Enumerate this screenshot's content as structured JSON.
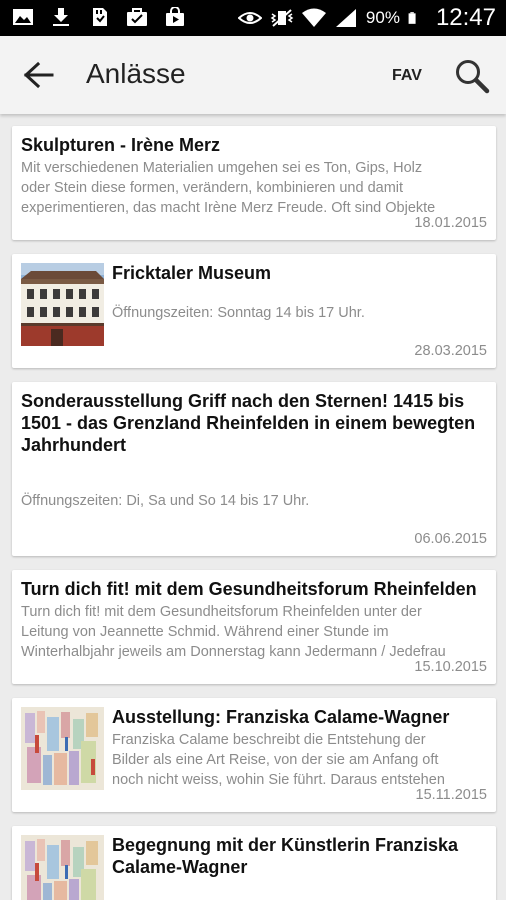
{
  "status_bar": {
    "battery_percent": "90%",
    "time": "12:47",
    "left_icons": [
      "image-icon",
      "download-icon",
      "sd-card-icon",
      "briefcase-check-icon",
      "shopping-bag-icon"
    ],
    "right_icons": [
      "eye-icon",
      "mute-vibrate-icon",
      "wifi-icon",
      "signal-icon",
      "battery-icon"
    ]
  },
  "appbar": {
    "title": "Anlässe",
    "fav_label": "FAV"
  },
  "events": [
    {
      "title": "Skulpturen - Irène Merz",
      "description_lines": [
        "Mit verschiedenen Materialien umgehen   sei es Ton, Gips, Holz",
        "oder Stein   diese formen, verändern, kombinieren und damit",
        "experimentieren, das macht Irène Merz Freude. Oft sind Objekte"
      ],
      "date": "18.01.2015",
      "has_image": false
    },
    {
      "title": "Fricktaler Museum",
      "description_lines": [
        "Öffnungszeiten: Sonntag 14 bis 17 Uhr."
      ],
      "date": "28.03.2015",
      "has_image": true,
      "image": "museum-building"
    },
    {
      "title_lines": [
        "Sonderausstellung Griff nach den Sternen! 1415 bis",
        "1501 - das Grenzland Rheinfelden in einem bewegten",
        "Jahrhundert"
      ],
      "description_lines": [
        "Öffnungszeiten: Di, Sa und So 14 bis 17 Uhr."
      ],
      "date": "06.06.2015",
      "has_image": false
    },
    {
      "title": "Turn dich fit! mit dem Gesundheitsforum Rheinfelden",
      "description_lines": [
        "Turn dich fit! mit dem Gesundheitsforum Rheinfelden unter der",
        "Leitung von Jeannette Schmid. Während einer Stunde im",
        "Winterhalbjahr jeweils am Donnerstag kann Jedermann / Jedefrau"
      ],
      "date": "15.10.2015",
      "has_image": false
    },
    {
      "title": "Ausstellung: Franziska Calame-Wagner",
      "description_lines": [
        "Franziska Calame beschreibt die Entstehung der",
        "Bilder als eine Art Reise, von der sie am Anfang oft",
        "noch nicht weiss, wohin Sie führt. Daraus entstehen"
      ],
      "date": "15.11.2015",
      "has_image": true,
      "image": "abstract-painting"
    },
    {
      "title_lines": [
        "Begegnung mit der Künstlerin Franziska",
        "Calame-Wagner"
      ],
      "has_image": true,
      "image": "abstract-painting"
    }
  ],
  "colors": {
    "status_bar": "#000000",
    "app_bar": "#f3f3f3",
    "background": "#ececec",
    "card": "#ffffff",
    "title_text": "#111111",
    "secondary_text": "#8c8c8c"
  }
}
